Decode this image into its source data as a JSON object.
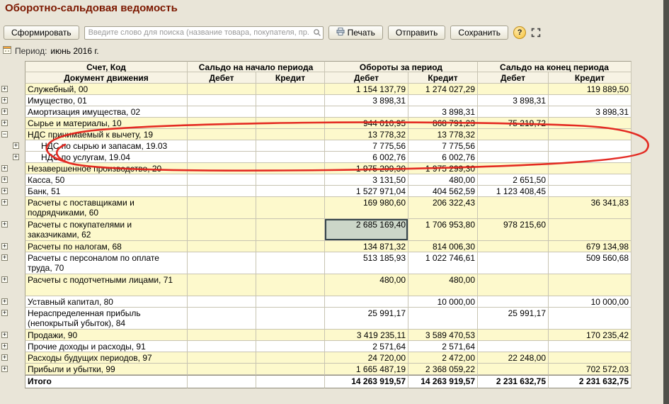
{
  "page": {
    "title": "Оборотно-сальдовая ведомость"
  },
  "toolbar": {
    "generate_label": "Сформировать",
    "search_placeholder": "Введите слово для поиска (название товара, покупателя, пр...",
    "print_label": "Печать",
    "send_label": "Отправить",
    "save_label": "Сохранить",
    "help_label": "?"
  },
  "period": {
    "label": "Период:",
    "value": "июнь 2016 г."
  },
  "colors": {
    "title": "#7c1800",
    "row_yellow": "#fdf9cc",
    "selection_fill": "#ccd6c8",
    "selection_border": "#36454a",
    "annotation_red": "#e32119"
  },
  "table": {
    "header": {
      "col_account": "Счет, Код",
      "col_doc": "Документ движения",
      "group_opening": "Сальдо на начало периода",
      "group_turnover": "Обороты за период",
      "group_closing": "Сальдо на конец периода",
      "debit": "Дебет",
      "credit": "Кредит"
    },
    "rows": [
      {
        "name": "Служебный, 00",
        "level": 0,
        "expander": "+",
        "shade": "yellow",
        "ob_d": "1 154 137,79",
        "ob_k": "1 274 027,29",
        "end_k": "119 889,50"
      },
      {
        "name": "Имущество, 01",
        "level": 0,
        "expander": "+",
        "shade": "white",
        "ob_d": "3 898,31",
        "end_d": "3 898,31"
      },
      {
        "name": "Амортизация имущества, 02",
        "level": 0,
        "expander": "+",
        "shade": "white",
        "ob_k": "3 898,31",
        "end_k": "3 898,31"
      },
      {
        "name": "Сырье и материалы, 10",
        "level": 0,
        "expander": "+",
        "shade": "yellow",
        "ob_d": "944 010,95",
        "ob_k": "868 791,23",
        "end_d": "75 219,72"
      },
      {
        "name": "НДС принимаемый к вычету, 19",
        "level": 0,
        "expander": "−",
        "shade": "yellow",
        "ob_d": "13 778,32",
        "ob_k": "13 778,32"
      },
      {
        "name": "НДС по сырью и запасам, 19.03",
        "level": 1,
        "expander": "+",
        "shade": "white",
        "ob_d": "7 775,56",
        "ob_k": "7 775,56"
      },
      {
        "name": "НДС по услугам, 19.04",
        "level": 1,
        "expander": "+",
        "shade": "white",
        "ob_d": "6 002,76",
        "ob_k": "6 002,76"
      },
      {
        "name": "Незавершенное производство, 20",
        "level": 0,
        "expander": "+",
        "shade": "yellow",
        "ob_d": "1 975 299,30",
        "ob_k": "1 975 299,30"
      },
      {
        "name": "Касса, 50",
        "level": 0,
        "expander": "+",
        "shade": "white",
        "ob_d": "3 131,50",
        "ob_k": "480,00",
        "end_d": "2 651,50"
      },
      {
        "name": "Банк, 51",
        "level": 0,
        "expander": "+",
        "shade": "white",
        "ob_d": "1 527 971,04",
        "ob_k": "404 562,59",
        "end_d": "1 123 408,45"
      },
      {
        "name": "Расчеты с поставщиками и подрядчиками, 60",
        "level": 0,
        "expander": "+",
        "shade": "yellow",
        "lines": 2,
        "ob_d": "169 980,60",
        "ob_k": "206 322,43",
        "end_k": "36 341,83"
      },
      {
        "name": "Расчеты с покупателями и заказчиками, 62",
        "level": 0,
        "expander": "+",
        "shade": "yellow",
        "lines": 2,
        "ob_d": "2 685 169,40",
        "ob_k": "1 706 953,80",
        "end_d": "978 215,60",
        "selected": "ob_d"
      },
      {
        "name": "Расчеты по налогам, 68",
        "level": 0,
        "expander": "+",
        "shade": "yellow",
        "ob_d": "134 871,32",
        "ob_k": "814 006,30",
        "end_k": "679 134,98"
      },
      {
        "name": "Расчеты с персоналом по оплате труда, 70",
        "level": 0,
        "expander": "+",
        "shade": "white",
        "lines": 2,
        "ob_d": "513 185,93",
        "ob_k": "1 022 746,61",
        "end_k": "509 560,68"
      },
      {
        "name": "Расчеты с подотчетными лицами, 71",
        "level": 0,
        "expander": "+",
        "shade": "yellow",
        "lines": 2,
        "ob_d": "480,00",
        "ob_k": "480,00"
      },
      {
        "name": "Уставный капитал, 80",
        "level": 0,
        "expander": "+",
        "shade": "white",
        "ob_k": "10 000,00",
        "end_k": "10 000,00"
      },
      {
        "name": "Нераспределенная прибыль (непокрытый убыток), 84",
        "level": 0,
        "expander": "+",
        "shade": "white",
        "lines": 2,
        "ob_d": "25 991,17",
        "end_d": "25 991,17"
      },
      {
        "name": "Продажи, 90",
        "level": 0,
        "expander": "+",
        "shade": "yellow",
        "ob_d": "3 419 235,11",
        "ob_k": "3 589 470,53",
        "end_k": "170 235,42"
      },
      {
        "name": "Прочие доходы и расходы, 91",
        "level": 0,
        "expander": "+",
        "shade": "white",
        "ob_d": "2 571,64",
        "ob_k": "2 571,64"
      },
      {
        "name": "Расходы будущих периодов, 97",
        "level": 0,
        "expander": "+",
        "shade": "yellow",
        "ob_d": "24 720,00",
        "ob_k": "2 472,00",
        "end_d": "22 248,00"
      },
      {
        "name": "Прибыли и убытки, 99",
        "level": 0,
        "expander": "+",
        "shade": "yellow",
        "ob_d": "1 665 487,19",
        "ob_k": "2 368 059,22",
        "end_k": "702 572,03"
      },
      {
        "name": "Итого",
        "level": 0,
        "shade": "total",
        "ob_d": "14 263 919,57",
        "ob_k": "14 263 919,57",
        "end_d": "2 231 632,75",
        "end_k": "2 231 632,75"
      }
    ]
  }
}
